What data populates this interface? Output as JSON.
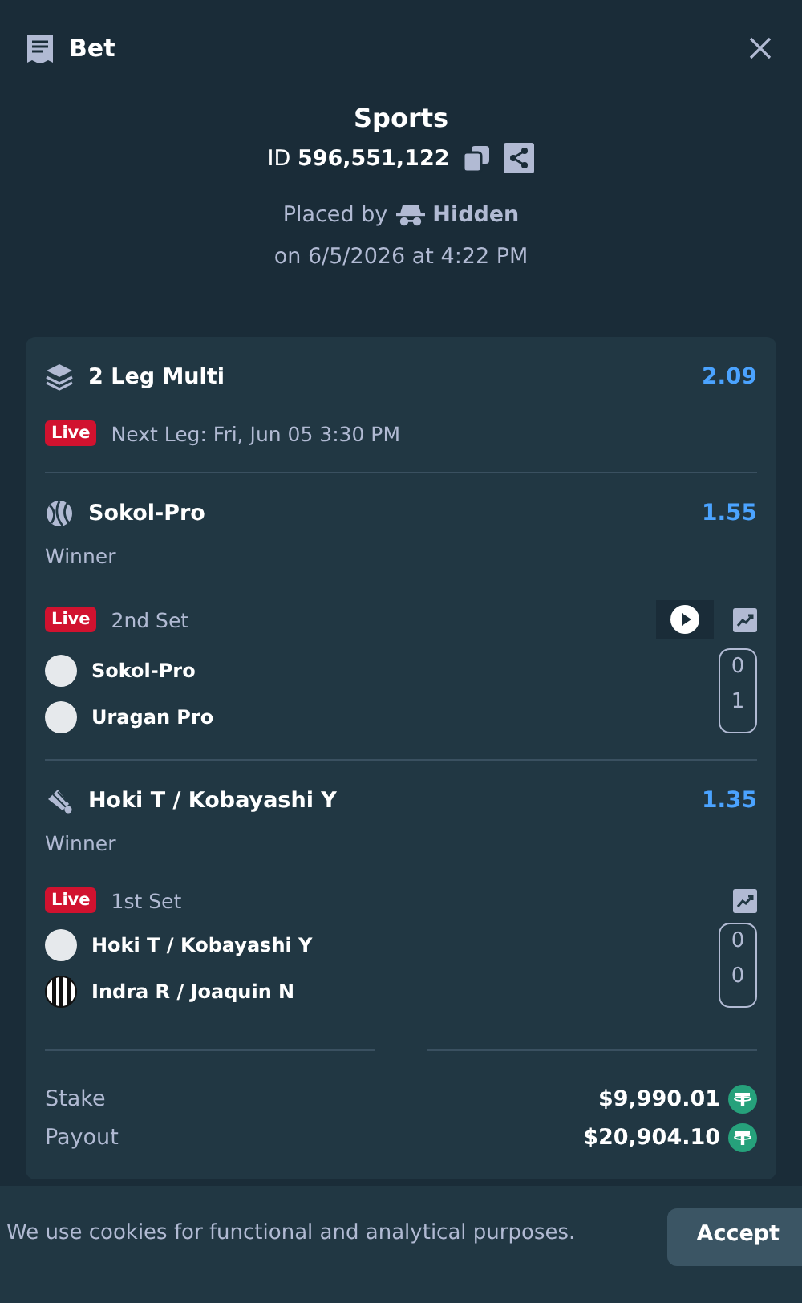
{
  "header": {
    "title": "Bet"
  },
  "summary": {
    "category": "Sports",
    "id_label": "ID",
    "id_value": "596,551,122",
    "placed_by_label": "Placed by",
    "placed_by_user": "Hidden",
    "placed_on": "on 6/5/2026 at 4:22 PM"
  },
  "multi": {
    "title": "2 Leg Multi",
    "odds": "2.09",
    "live_badge": "Live",
    "next_leg": "Next Leg: Fri, Jun 05 3:30 PM"
  },
  "legs": [
    {
      "kind": "tennis",
      "name": "Sokol-Pro",
      "odds": "1.55",
      "market": "Winner",
      "live_badge": "Live",
      "period": "2nd Set",
      "stream": true,
      "players": [
        {
          "name": "Sokol-Pro",
          "kind": "plain",
          "score": "0"
        },
        {
          "name": "Uragan Pro",
          "kind": "plain",
          "score": "1"
        }
      ]
    },
    {
      "kind": "badminton",
      "name": "Hoki T / Kobayashi Y",
      "odds": "1.35",
      "market": "Winner",
      "live_badge": "Live",
      "period": "1st Set",
      "stream": false,
      "players": [
        {
          "name": "Hoki T / Kobayashi Y",
          "kind": "plain",
          "score": "0"
        },
        {
          "name": "Indra R / Joaquin N",
          "kind": "striped",
          "score": "0"
        }
      ]
    }
  ],
  "totals": [
    {
      "label": "Stake",
      "value": "$9,990.01"
    },
    {
      "label": "Payout",
      "value": "$20,904.10"
    }
  ],
  "cookie_bar": {
    "text": "We use cookies for functional and analytical purposes.",
    "button": "Accept"
  }
}
